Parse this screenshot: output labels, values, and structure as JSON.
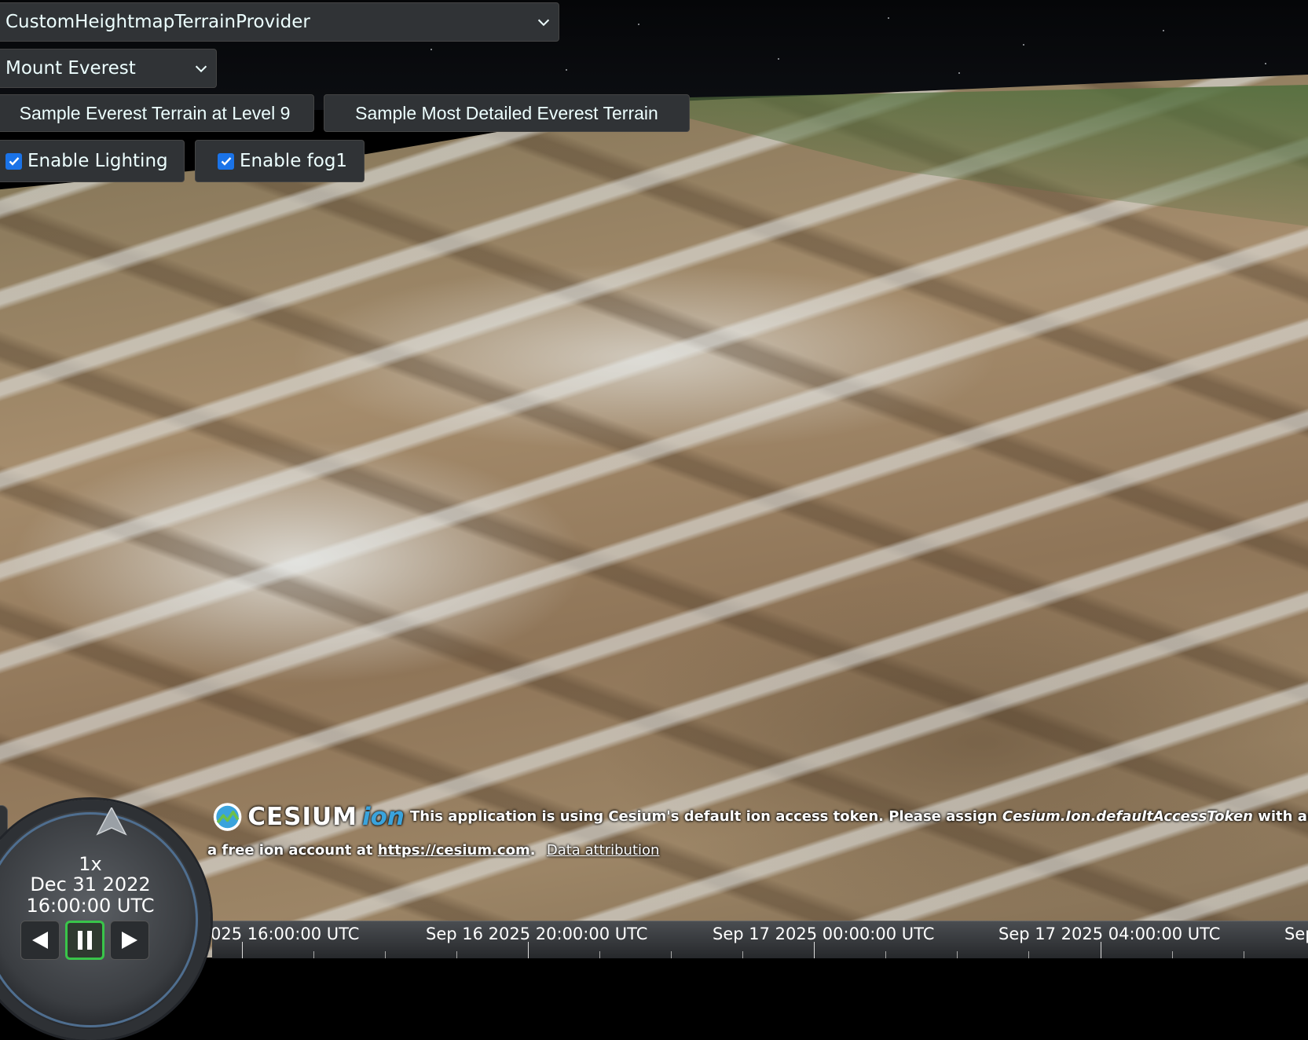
{
  "toolbar": {
    "terrain_provider_select": "CustomHeightmapTerrainProvider",
    "location_select": "Mount Everest",
    "sample_level9_button": "Sample Everest Terrain at Level 9",
    "sample_most_detailed_button": "Sample Most Detailed Everest Terrain",
    "lighting_checkbox": {
      "label": "Enable Lighting",
      "checked": true
    },
    "fog_checkbox": {
      "label": "Enable fog1",
      "checked": true
    }
  },
  "animation": {
    "speed": "1x",
    "date": "Dec 31 2022",
    "time": "16:00:00 UTC",
    "paused": true
  },
  "credits": {
    "logo_main": "CESIUM",
    "logo_sub": "ion",
    "message_part1": "This application is using Cesium's default ion access token. Please assign ",
    "message_code": "Cesium.Ion.defaultAccessToken",
    "message_part2": " with an acce",
    "message_line2": "a free ion account at ",
    "message_link": "https://cesium.com",
    "message_end": ".",
    "data_attribution": "Data attribution"
  },
  "timeline": {
    "labels": [
      "025 16:00:00 UTC",
      "Sep 16 2025 20:00:00 UTC",
      "Sep 17 2025 00:00:00 UTC",
      "Sep 17 2025 04:00:00 UTC",
      "Sep"
    ]
  },
  "colors": {
    "checkbox_accent": "#1a73e8",
    "ion_blue": "#3aa3dc",
    "control_bg": "#303336",
    "play_active": "#39c54a"
  }
}
